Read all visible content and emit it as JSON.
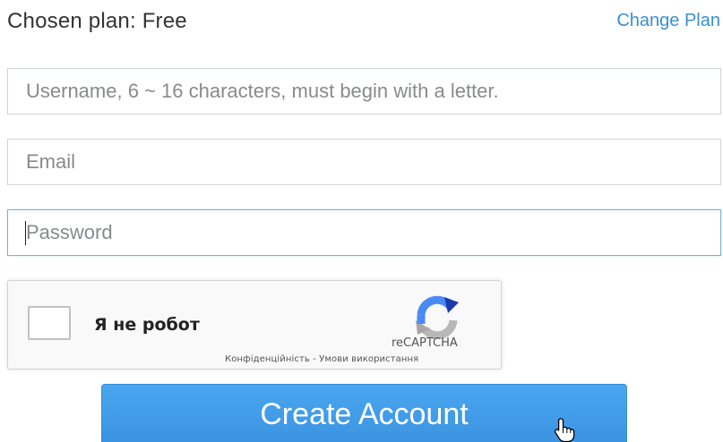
{
  "plan": {
    "title": "Chosen plan: Free",
    "change_link": "Change Plan"
  },
  "form": {
    "username_placeholder": "Username, 6 ~ 16 characters, must begin with a letter.",
    "email_placeholder": "Email",
    "password_placeholder": "Password"
  },
  "recaptcha": {
    "label": "Я не робот",
    "brand": "reCAPTCHA",
    "privacy_link": "Конфіденційність",
    "separator": " - ",
    "terms_link": "Умови використання",
    "logo_icon": "recaptcha-logo-icon"
  },
  "actions": {
    "create_label": "Create Account"
  },
  "colors": {
    "link": "#3a8fd0",
    "button": "#3f9be6",
    "focus_border": "#7fb0d6"
  },
  "cursor": {
    "icon": "hand-pointer-icon"
  }
}
